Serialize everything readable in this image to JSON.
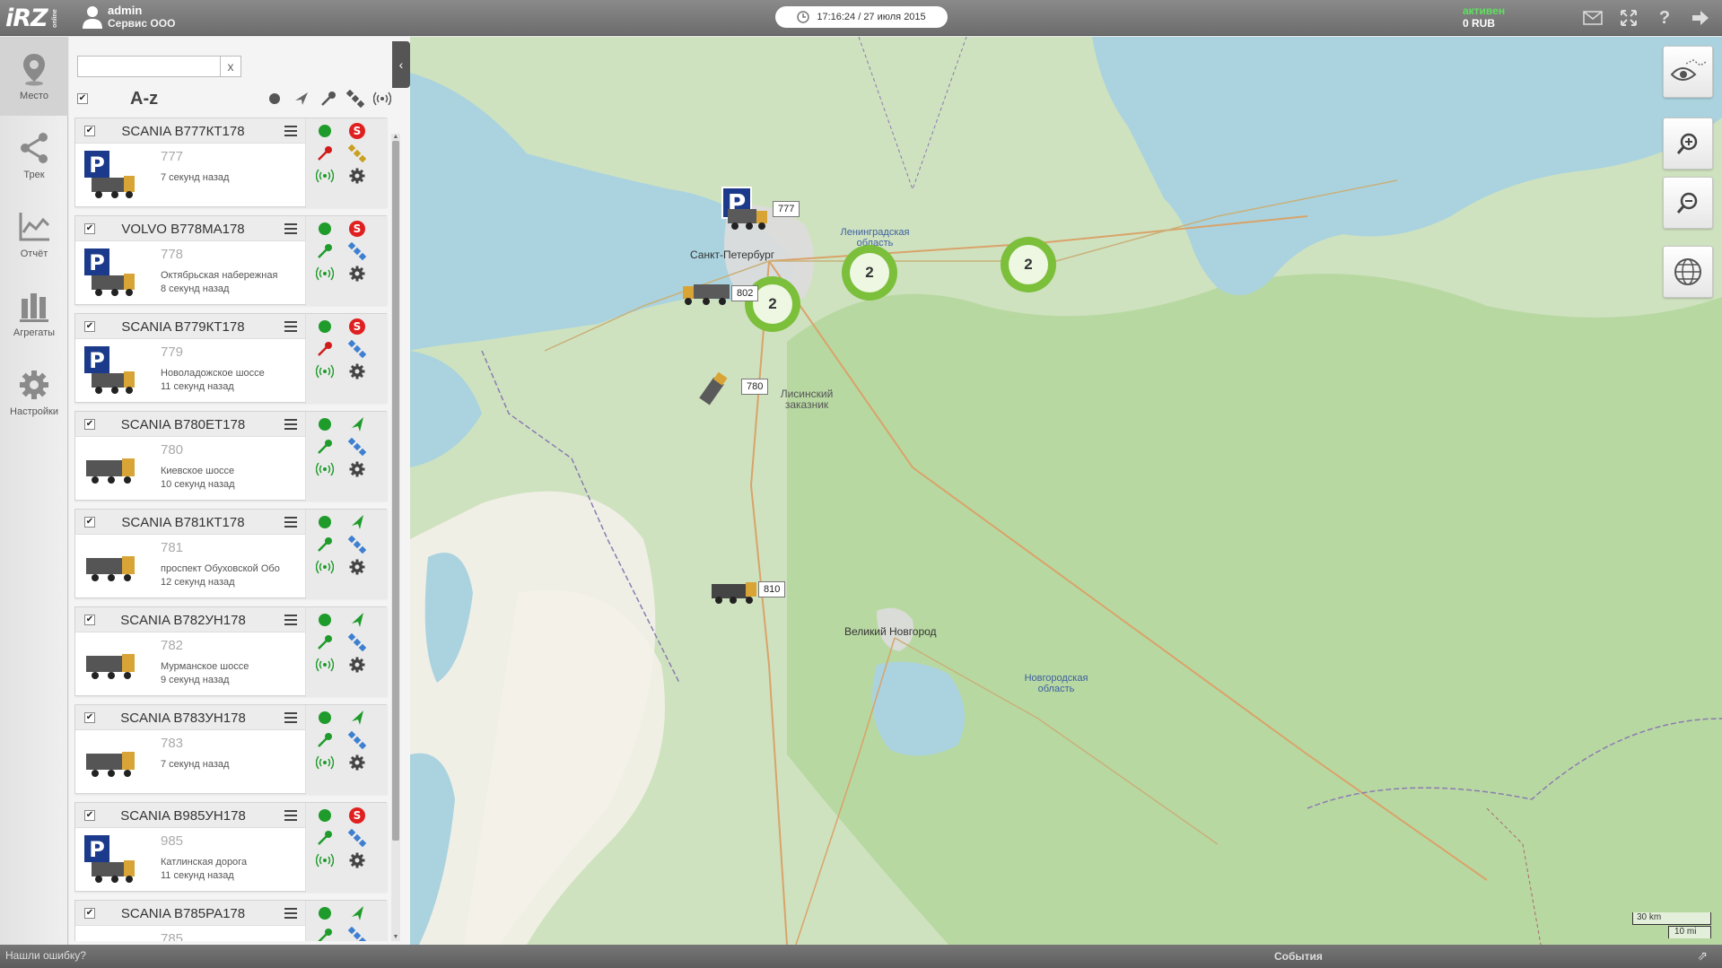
{
  "app": {
    "logo": "iRZ",
    "logo_sub": "online",
    "user_name": "admin",
    "company": "Сервис ООО",
    "datetime": "17:16:24 / 27 июля 2015",
    "status": "активен",
    "balance": "0 RUB"
  },
  "topbar_icons": [
    "mail-icon",
    "fullscreen-icon",
    "help-icon",
    "logout-icon"
  ],
  "nav": [
    {
      "label": "Место",
      "icon": "location-pin-icon",
      "active": true
    },
    {
      "label": "Трек",
      "icon": "share-track-icon",
      "active": false
    },
    {
      "label": "Отчёт",
      "icon": "chart-report-icon",
      "active": false
    },
    {
      "label": "Агрегаты",
      "icon": "aggregates-icon",
      "active": false
    },
    {
      "label": "Настройки",
      "icon": "gear-icon",
      "active": false
    }
  ],
  "list": {
    "search_value": "",
    "clear_label": "x",
    "sort_label": "A-z",
    "header_icons": [
      "status-dot-icon",
      "direction-icon",
      "ignition-key-icon",
      "satellite-icon",
      "signal-icon"
    ]
  },
  "vehicles": [
    {
      "title": "SCANIA В777КТ178",
      "number": "777",
      "address": "",
      "ago": "7 секунд назад",
      "parked": true,
      "key": "red",
      "badge": "S",
      "sat": "yellow"
    },
    {
      "title": "VOLVO В778МА178",
      "number": "778",
      "address": "Октябрьская набережная",
      "ago": "8 секунд назад",
      "parked": true,
      "key": "green",
      "badge": "S",
      "sat": "blue"
    },
    {
      "title": "SCANIA В779КТ178",
      "number": "779",
      "address": "Новоладожское шоссе",
      "ago": "11 секунд назад",
      "parked": true,
      "key": "red",
      "badge": "S",
      "sat": "blue"
    },
    {
      "title": "SCANIA В780ЕТ178",
      "number": "780",
      "address": "Киевское шоссе",
      "ago": "10 секунд назад",
      "parked": false,
      "key": "green",
      "badge": "arrow",
      "sat": "blue"
    },
    {
      "title": "SCANIA В781КТ178",
      "number": "781",
      "address": "проспект Обуховской Обо",
      "ago": "12 секунд назад",
      "parked": false,
      "key": "green",
      "badge": "arrow",
      "sat": "blue"
    },
    {
      "title": "SCANIA В782УН178",
      "number": "782",
      "address": "Мурманское шоссе",
      "ago": "9 секунд назад",
      "parked": false,
      "key": "green",
      "badge": "arrow",
      "sat": "blue"
    },
    {
      "title": "SCANIA В783УН178",
      "number": "783",
      "address": "",
      "ago": "7 секунд назад",
      "parked": false,
      "key": "green",
      "badge": "arrow",
      "sat": "blue"
    },
    {
      "title": "SCANIA В985УН178",
      "number": "985",
      "address": "Катлинская дорога",
      "ago": "11 секунд назад",
      "parked": true,
      "key": "green",
      "badge": "S",
      "sat": "blue"
    },
    {
      "title": "SCANIA В785РА178",
      "number": "785",
      "address": "",
      "ago": "",
      "parked": false,
      "key": "green",
      "badge": "arrow",
      "sat": "blue"
    }
  ],
  "map": {
    "labels": {
      "spb": "Санкт-Петербург",
      "leningrad_obl": "Ленинградская область",
      "lisiy": "Лисинский заказник",
      "novgorod": "Великий Новгород",
      "novgorod_obl": "Новгородская область"
    },
    "clusters": [
      "2",
      "2",
      "2"
    ],
    "markers": [
      "777",
      "802",
      "780",
      "810"
    ],
    "controls": [
      "layers-eye-icon",
      "zoom-in-icon",
      "zoom-out-icon",
      "globe-icon"
    ],
    "scale_km": "30 km",
    "scale_mi": "10 mi"
  },
  "footer": {
    "bug_link": "Нашли ошибку?",
    "events": "События"
  },
  "colors": {
    "status_green": "#5fe05f",
    "cluster_green": "#7bbf3a",
    "badge_red": "#e02020",
    "ok_green": "#1e9b2a"
  }
}
